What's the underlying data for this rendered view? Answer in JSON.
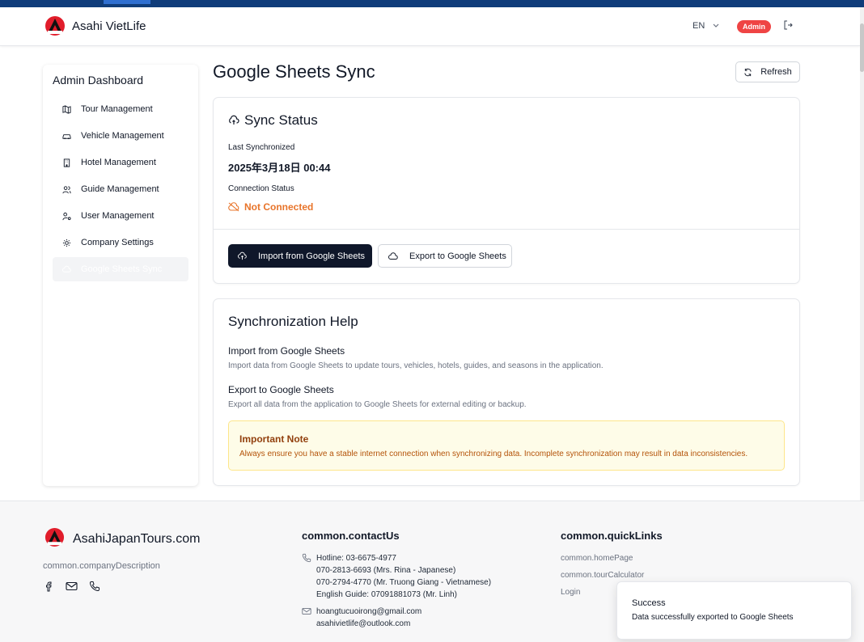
{
  "header": {
    "brand": "Asahi VietLife",
    "language": "EN",
    "role_badge": "Admin"
  },
  "sidebar": {
    "title": "Admin Dashboard",
    "items": [
      {
        "label": "Tour Management",
        "icon": "map-icon"
      },
      {
        "label": "Vehicle Management",
        "icon": "car-icon"
      },
      {
        "label": "Hotel Management",
        "icon": "building-icon"
      },
      {
        "label": "Guide Management",
        "icon": "users-icon"
      },
      {
        "label": "User Management",
        "icon": "user-key-icon"
      },
      {
        "label": "Company Settings",
        "icon": "gear-icon"
      },
      {
        "label": "Google Sheets Sync",
        "icon": "cloud-icon",
        "active": true
      }
    ]
  },
  "main": {
    "title": "Google Sheets Sync",
    "refresh_label": "Refresh",
    "sync_status": {
      "title": "Sync Status",
      "last_sync_label": "Last Synchronized",
      "last_sync_value": "2025年3月18日 00:44",
      "connection_label": "Connection Status",
      "connection_value": "Not Connected",
      "import_button": "Import from Google Sheets",
      "export_button": "Export to Google Sheets"
    },
    "help": {
      "title": "Synchronization Help",
      "import_title": "Import from Google Sheets",
      "import_desc": "Import data from Google Sheets to update tours, vehicles, hotels, guides, and seasons in the application.",
      "export_title": "Export to Google Sheets",
      "export_desc": "Export all data from the application to Google Sheets for external editing or backup.",
      "note_title": "Important Note",
      "note_text": "Always ensure you have a stable internet connection when synchronizing data. Incomplete synchronization may result in data inconsistencies."
    }
  },
  "footer": {
    "brand": "AsahiJapanTours.com",
    "description": "common.companyDescription",
    "contact_title": "common.contactUs",
    "hotline_lines": [
      "Hotline: 03-6675-4977",
      "070-2813-6693 (Mrs. Rina - Japanese)",
      "070-2794-4770 (Mr. Truong Giang - Vietnamese)",
      "English Guide: 07091881073 (Mr. Linh)"
    ],
    "emails": [
      "hoangtucuoirong@gmail.com",
      "asahivietlife@outlook.com"
    ],
    "quicklinks_title": "common.quickLinks",
    "links": [
      "common.homePage",
      "common.tourCalculator",
      "Login"
    ]
  },
  "toast": {
    "title": "Success",
    "message": "Data successfully exported to Google Sheets"
  },
  "colors": {
    "primary_dark": "#0f172a",
    "danger_badge": "#ef4444",
    "warning_text": "#e8742a",
    "note_bg": "#fefce8"
  }
}
